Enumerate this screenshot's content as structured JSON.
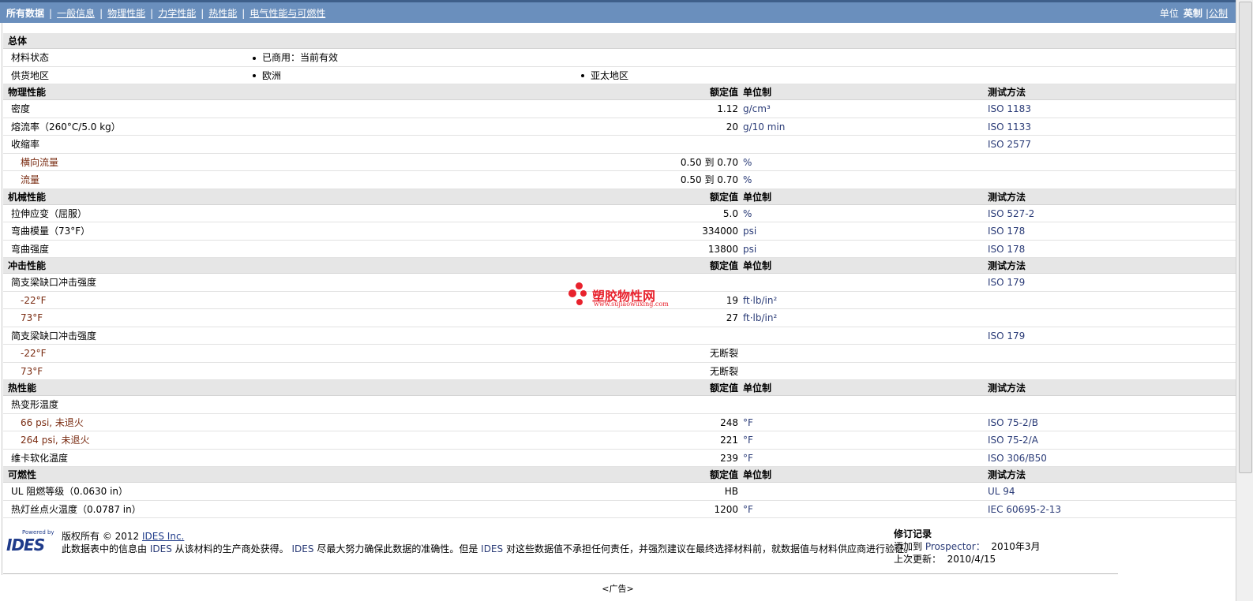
{
  "nav": {
    "tabs": [
      "所有数据",
      "一般信息",
      "物理性能",
      "力学性能",
      "热性能",
      "电气性能与可燃性"
    ],
    "active_index": 0,
    "unit_label": "单位",
    "unit_active": "英制",
    "unit_alt": "公制"
  },
  "headers": {
    "nominal": "额定值",
    "unit": "单位制",
    "method": "测试方法"
  },
  "general": {
    "title": "总体",
    "material_status_label": "材料状态",
    "material_status": "已商用：当前有效",
    "supply_region_label": "供货地区",
    "region1": "欧洲",
    "region2": "亚太地区"
  },
  "sections": [
    {
      "title": "物理性能",
      "rows": [
        {
          "name": "密度",
          "nominal": "1.12",
          "unit": "g/cm³",
          "method": "ISO 1183"
        },
        {
          "name": "熔流率（260°C/5.0 kg）",
          "nominal": "20",
          "unit": "g/10 min",
          "method": "ISO 1133"
        },
        {
          "name": "收缩率",
          "nominal": "",
          "unit": "",
          "method": "ISO 2577"
        },
        {
          "name": "横向流量",
          "sub": true,
          "nominal": "0.50 到  0.70",
          "unit": "%",
          "method": ""
        },
        {
          "name": "流量",
          "sub": true,
          "nominal": "0.50 到  0.70",
          "unit": "%",
          "method": ""
        }
      ]
    },
    {
      "title": "机械性能",
      "rows": [
        {
          "name": "拉伸应变（屈服）",
          "nominal": "5.0",
          "unit": "%",
          "method": "ISO 527-2"
        },
        {
          "name": "弯曲模量（73°F）",
          "nominal": "334000",
          "unit": "psi",
          "method": "ISO 178"
        },
        {
          "name": "弯曲强度",
          "nominal": "13800",
          "unit": "psi",
          "method": "ISO 178"
        }
      ]
    },
    {
      "title": "冲击性能",
      "rows": [
        {
          "name": "简支梁缺口冲击强度",
          "nominal": "",
          "unit": "",
          "method": "ISO 179"
        },
        {
          "name": "-22°F",
          "sub": true,
          "nominal": "19",
          "unit": "ft·lb/in²",
          "method": ""
        },
        {
          "name": "73°F",
          "sub": true,
          "nominal": "27",
          "unit": "ft·lb/in²",
          "method": ""
        },
        {
          "name": "简支梁缺口冲击强度",
          "nominal": "",
          "unit": "",
          "method": "ISO 179"
        },
        {
          "name": "-22°F",
          "sub": true,
          "nominal": "无断裂",
          "unit": "",
          "method": ""
        },
        {
          "name": "73°F",
          "sub": true,
          "nominal": "无断裂",
          "unit": "",
          "method": ""
        }
      ]
    },
    {
      "title": "热性能",
      "rows": [
        {
          "name": "热变形温度",
          "nominal": "",
          "unit": "",
          "method": ""
        },
        {
          "name": "66 psi, 未退火",
          "sub": true,
          "nominal": "248",
          "unit": "°F",
          "method": "ISO 75-2/B"
        },
        {
          "name": "264 psi, 未退火",
          "sub": true,
          "nominal": "221",
          "unit": "°F",
          "method": "ISO 75-2/A"
        },
        {
          "name": "维卡软化温度",
          "nominal": "239",
          "unit": "°F",
          "method": "ISO 306/B50"
        }
      ]
    },
    {
      "title": "可燃性",
      "rows": [
        {
          "name": "UL 阻燃等级（0.0630 in）",
          "nominal": "HB",
          "unit": "",
          "method": "UL 94"
        },
        {
          "name": "热灯丝点火温度（0.0787 in）",
          "nominal": "1200",
          "unit": "°F",
          "method": "IEC 60695-2-13"
        }
      ]
    }
  ],
  "watermark": {
    "text": "塑胶物性网",
    "url": "www.sujiaowuxing.com"
  },
  "footer": {
    "powered": "Powered by",
    "logo": "IDES",
    "copyright": "版权所有  © 2012",
    "company_link": "IDES Inc.",
    "disclaimer_1": "此数据表中的信息由",
    "disclaimer_2": "从该材料的生产商处获得。",
    "disclaimer_3": "尽最大努力确保此数据的准确性。但是",
    "disclaimer_4": "对这些数据值不承担任何责任，并强烈建议在最终选择材料前，就数据值与材料供应商进行验证。",
    "ides_word": "IDES",
    "revision_title": "修订记录",
    "added_label": "添加到",
    "added_target": "Prospector：",
    "added_date": "2010年3月",
    "updated_label": "上次更新：",
    "updated_date": "2010/4/15"
  },
  "ad": "<广告>"
}
